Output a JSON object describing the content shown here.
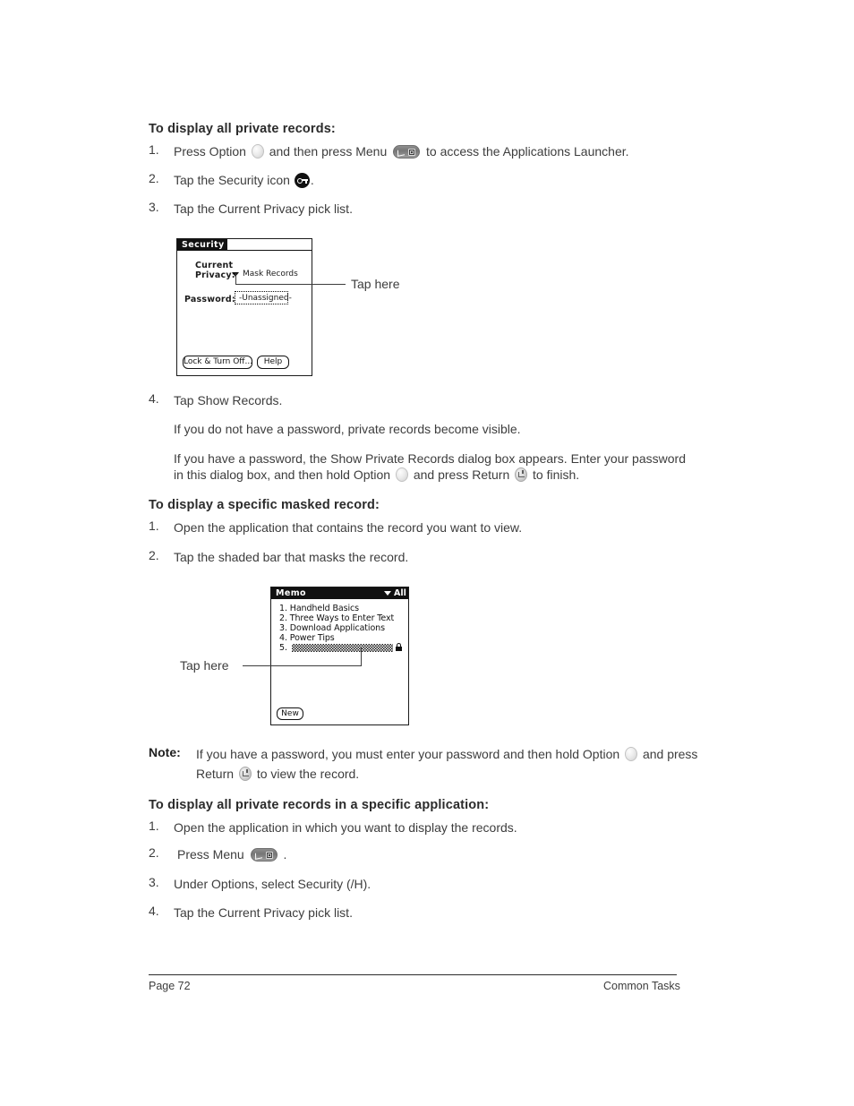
{
  "document": {
    "footer": {
      "page_label": "Page 72",
      "section_label": "Common Tasks"
    }
  },
  "section_private_records": {
    "heading": "To display all private records:",
    "steps": [
      {
        "num": "1.",
        "pre": "Press Option",
        "mid": "and then press Menu",
        "post": "to access the Applications Launcher."
      },
      {
        "num": "2.",
        "pre": "Tap the Security icon",
        "post": "."
      },
      {
        "num": "3.",
        "text": "Tap the Current Privacy pick list."
      },
      {
        "num": "4.",
        "text": "Tap Show Records."
      }
    ],
    "paragraph_no_password": "If you do not have a password, private records become visible.",
    "paragraph_with_password_line1": "If you have a password, the Show Private Records dialog box appears. Enter your password",
    "paragraph_with_password_line2_a": "in this dialog box, and then hold Option",
    "paragraph_with_password_line2_b": "and press Return",
    "paragraph_with_password_line2_c": "to finish."
  },
  "security_dialog": {
    "title": "Security",
    "current_privacy_label_line1": "Current",
    "current_privacy_label_line2": "Privacy:",
    "current_privacy_value": "Mask Records",
    "password_label": "Password:",
    "password_value": "-Unassigned-",
    "buttons": [
      {
        "label": "Lock & Turn Off..."
      },
      {
        "label": "Help"
      }
    ],
    "callout": "Tap here"
  },
  "section_masked_record": {
    "heading": "To display a specific masked record:",
    "steps": [
      {
        "num": "1.",
        "text": "Open the application that contains the record you want to view."
      },
      {
        "num": "2.",
        "text": "Tap the shaded bar that masks the record."
      }
    ]
  },
  "memo_app": {
    "title": "Memo",
    "category": "All",
    "items": [
      "1. Handheld Basics",
      "2. Three Ways to Enter Text",
      "3. Download Applications",
      "4. Power Tips"
    ],
    "masked_row_number": "5.",
    "new_button": "New",
    "callout": "Tap here"
  },
  "note": {
    "label": "Note:",
    "line1_a": "If you have a password, you must enter your password and then hold Option",
    "line1_b": "and press",
    "line2_a": "Return",
    "line2_b": "to view the record."
  },
  "section_specific_application": {
    "heading": "To display all private records in a specific application:",
    "steps": [
      {
        "num": "1.",
        "text": "Open the application in which you want to display the records."
      },
      {
        "num": "2.",
        "pre": "Press Menu",
        "post": "."
      },
      {
        "num": "3.",
        "text": "Under Options, select Security (/H)."
      },
      {
        "num": "4.",
        "text": "Tap the Current Privacy pick list."
      }
    ]
  },
  "icons": {
    "option_key": "option-key-icon",
    "menu_key": "menu-key-icon",
    "return_key": "return-key-icon",
    "security": "security-key-icon",
    "lock": "lock-icon",
    "pick_list_triangle": "chevron-down-icon"
  },
  "colors": {
    "text": "#3d3d3d",
    "heading": "#2b2b2b",
    "device_outline": "#1b1b1b",
    "titlebar_bg": "#111111"
  }
}
